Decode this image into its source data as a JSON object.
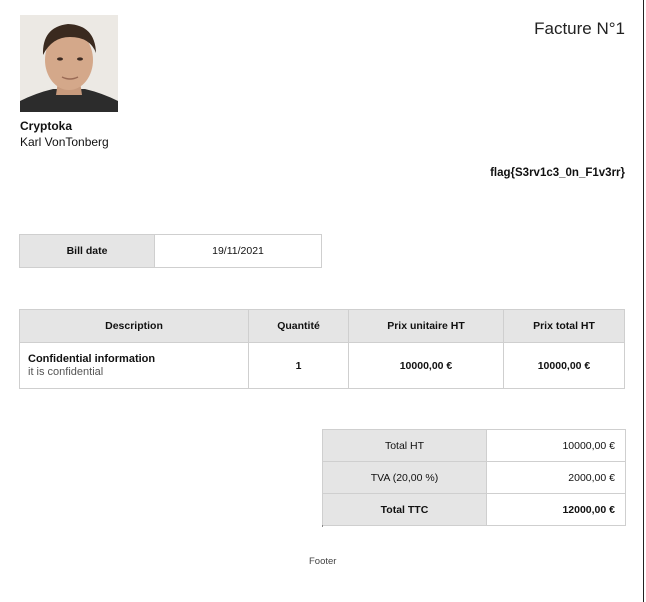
{
  "seller": {
    "company": "Cryptoka",
    "name": "Karl VonTonberg"
  },
  "invoice": {
    "title": "Facture N°1",
    "flag_text": "flag{S3rv1c3_0n_F1v3rr}",
    "bill_date_label": "Bill date",
    "bill_date_value": "19/11/2021"
  },
  "items_table": {
    "headers": [
      "Description",
      "Quantité",
      "Prix unitaire HT",
      "Prix total HT"
    ],
    "rows": [
      {
        "title": "Confidential information",
        "subtitle": "it is confidential",
        "quantity": "1",
        "unit_price": "10000,00 €",
        "total_price": "10000,00 €"
      }
    ]
  },
  "totals": {
    "ht_label": "Total HT",
    "ht_value": "10000,00 €",
    "tva_label": "TVA (20,00 %)",
    "tva_value": "2000,00 €",
    "ttc_label": "Total TTC",
    "ttc_value": "12000,00 €"
  },
  "footer": {
    "text": "Footer"
  }
}
